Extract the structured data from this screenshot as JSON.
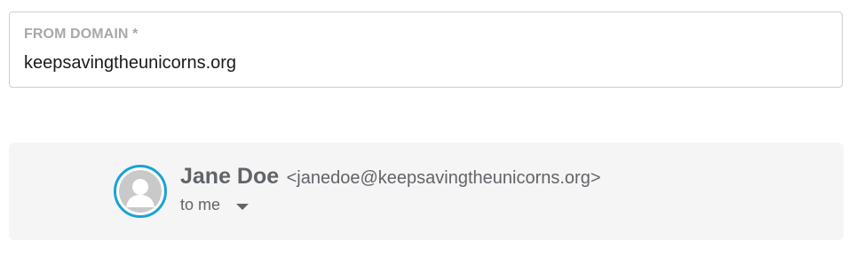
{
  "from_domain_field": {
    "label": "FROM DOMAIN *",
    "value": "keepsavingtheunicorns.org"
  },
  "email_preview": {
    "sender_name": "Jane Doe",
    "sender_email": "<janedoe@keepsavingtheunicorns.org>",
    "recipient_text": "to me",
    "avatar_icon": "user-silhouette-icon",
    "dropdown_icon": "caret-down-icon",
    "colors": {
      "avatar_ring": "#1aa3d4",
      "text": "#616468",
      "card_background": "#f5f5f5"
    }
  }
}
